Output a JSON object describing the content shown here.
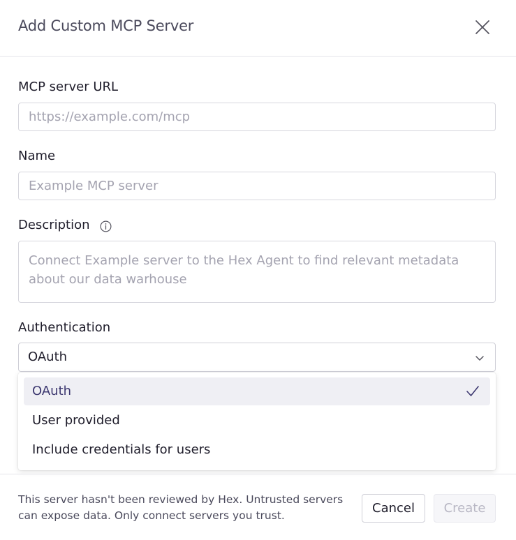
{
  "dialog": {
    "title": "Add Custom MCP Server"
  },
  "fields": {
    "url": {
      "label": "MCP server URL",
      "placeholder": "https://example.com/mcp",
      "value": ""
    },
    "name": {
      "label": "Name",
      "placeholder": "Example MCP server",
      "value": ""
    },
    "description": {
      "label": "Description",
      "placeholder": "Connect Example server to the Hex Agent to find relevant metadata about our data warhouse",
      "value": ""
    },
    "authentication": {
      "label": "Authentication",
      "selected": "OAuth",
      "options": [
        "OAuth",
        "User provided",
        "Include credentials for users"
      ]
    }
  },
  "footer": {
    "warning": "This server hasn't been reviewed by Hex. Untrusted servers can expose data. Only connect servers you trust.",
    "cancel_label": "Cancel",
    "create_label": "Create"
  },
  "icons": {
    "close": "close-icon",
    "info": "info-icon",
    "chevron": "chevron-down-icon",
    "check": "check-icon"
  },
  "colors": {
    "selected_option_bg": "#efeff4",
    "selected_option_text": "#3d3870",
    "disabled_button_text": "#b8b7c4"
  }
}
